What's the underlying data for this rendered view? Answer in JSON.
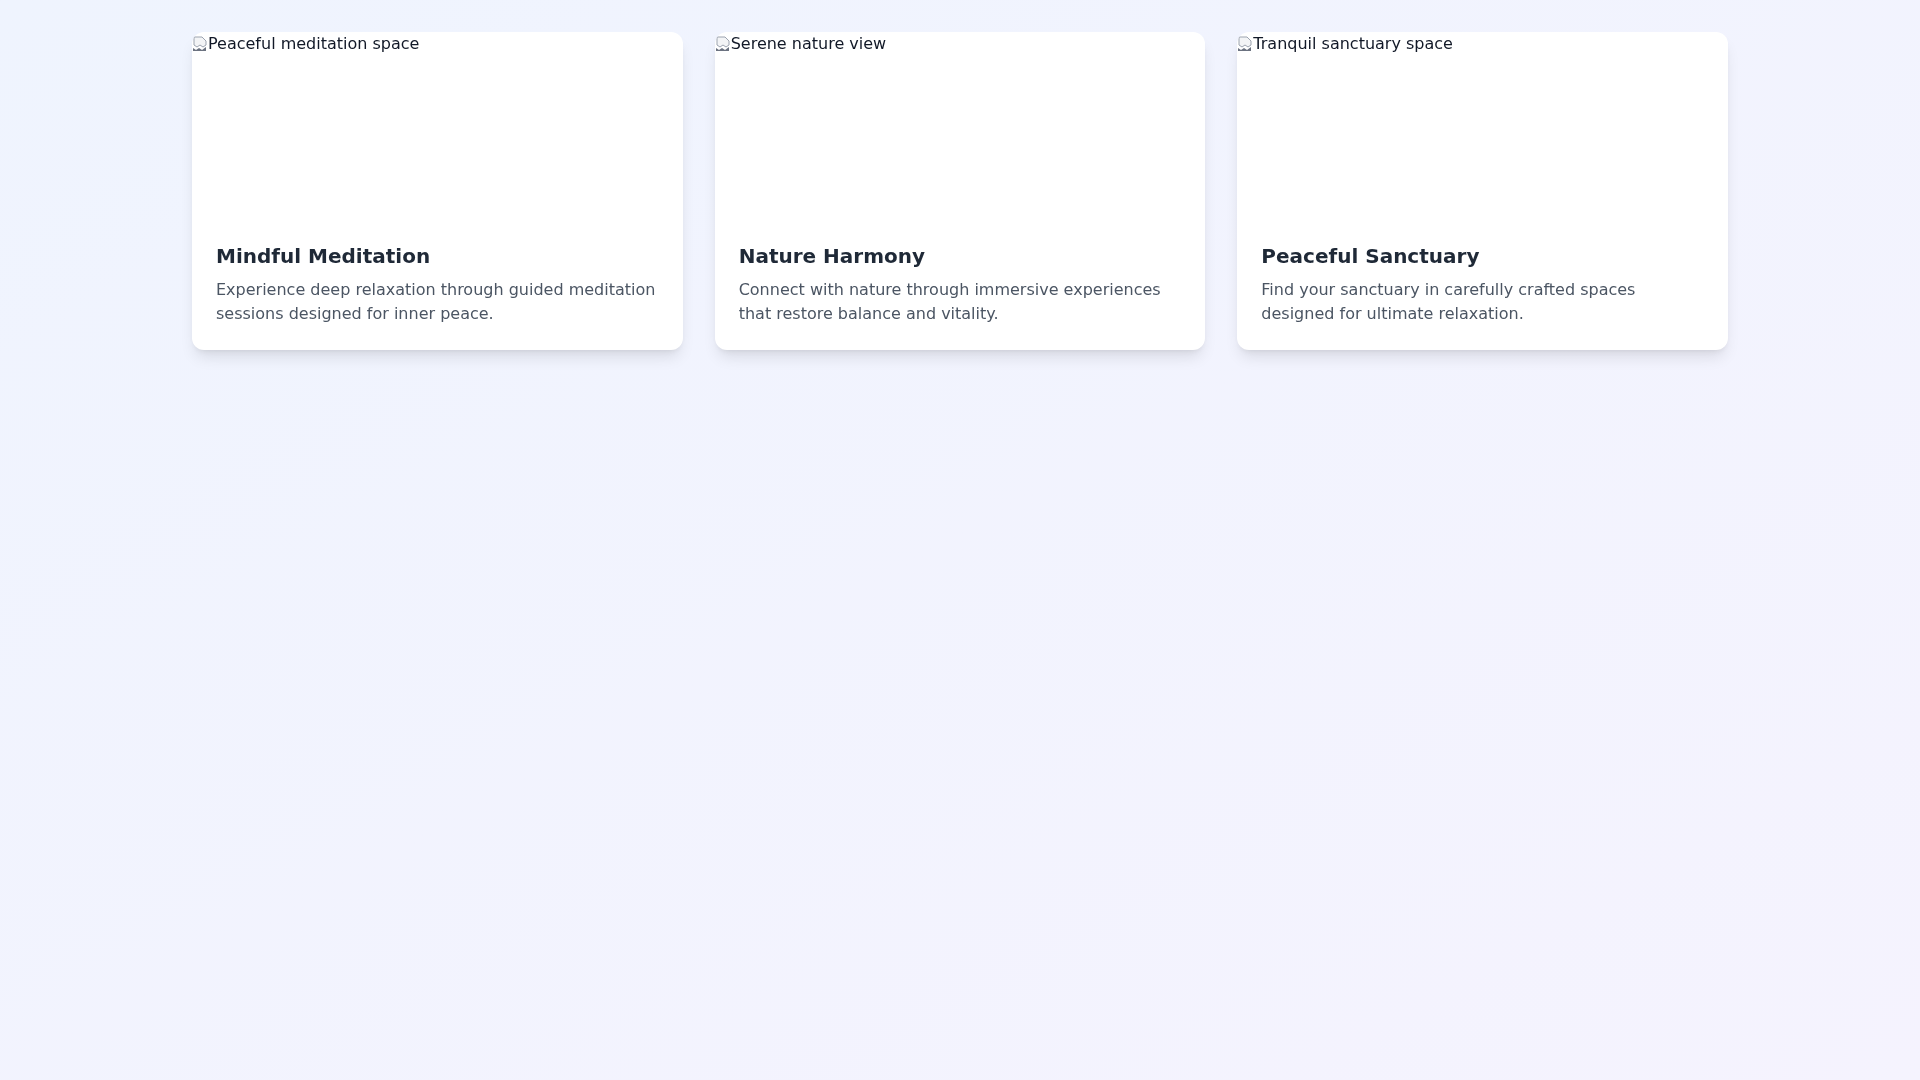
{
  "cards": [
    {
      "image_alt": "Peaceful meditation space",
      "title": "Mindful Meditation",
      "description": "Experience deep relaxation through guided meditation sessions designed for inner peace."
    },
    {
      "image_alt": "Serene nature view",
      "title": "Nature Harmony",
      "description": "Connect with nature through immersive experiences that restore balance and vitality."
    },
    {
      "image_alt": "Tranquil sanctuary space",
      "title": "Peaceful Sanctuary",
      "description": "Find your sanctuary in carefully crafted spaces designed for ultimate relaxation."
    }
  ]
}
